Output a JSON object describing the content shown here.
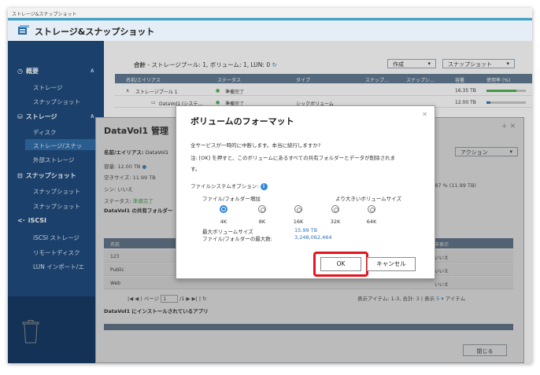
{
  "window_title": "ストレージ&スナップショット",
  "app": {
    "name": "ストレージ&スナップショット"
  },
  "sidebar": {
    "sections": [
      {
        "label": "概要",
        "items": [
          "ストレージ",
          "スナップショット"
        ]
      },
      {
        "label": "ストレージ",
        "items": [
          "ディスク",
          "ストレージ/スナッ",
          "外部ストレージ"
        ]
      },
      {
        "label": "スナップショット",
        "items": [
          "スナップショット",
          "スナップショット"
        ]
      },
      {
        "label": "iSCSI",
        "items": [
          "iSCSI ストレージ",
          "リモートディスク",
          "LUN インポート/エ"
        ]
      }
    ]
  },
  "main": {
    "summary_label": "合計",
    "summary_text": "- ストレージプール: 1, ボリューム: 1, LUN: 0",
    "buttons": {
      "create": "作成",
      "snapshot": "スナップショット"
    },
    "columns": [
      "名前/エイリアス",
      "ステータス",
      "タイプ",
      "スナップ...",
      "スナップシ...",
      "容量",
      "使用率 (%)"
    ],
    "rows": [
      {
        "name": "ストレージプール 1",
        "status": "準備完了",
        "type": "",
        "capacity": "16.35 TB",
        "usage": 0.75
      },
      {
        "name": "DataVol1 (システ...",
        "status": "準備完了",
        "type": "シックボリューム",
        "capacity": "12.00 TB",
        "usage": 0.1
      }
    ]
  },
  "manager": {
    "title": "DataVol1 管理",
    "name_label": "名前/エイリアス:",
    "name_value": "DataVol1",
    "capacity_label": "容量:",
    "capacity_value": "12.00 TB",
    "free_label": "空きサイズ:",
    "free_value": "11.99 TB",
    "thin_label": "シン:",
    "thin_value": "いいえ",
    "status_label": "ステータス:",
    "status_value": "準備完了",
    "shared_header": "DataVol1 の共有フォルダー",
    "usage_note": "9.87 % (11.99 TB)",
    "action_button": "アクション",
    "table_cols": [
      "名前",
      "非表示"
    ],
    "shares": [
      {
        "name": "123",
        "hidden": "いいえ"
      },
      {
        "name": "Public",
        "hidden": "いいえ"
      },
      {
        "name": "Web",
        "hidden": "いいえ"
      }
    ],
    "pager": {
      "page_label": "ページ",
      "page": "1",
      "total": "/1",
      "items": "表示アイテム: 1-3, 合計: 3",
      "show_label": "表示",
      "show_value": "5",
      "items_unit": "アイテム"
    },
    "apps_header": "DataVol1 にインストールされているアプリ",
    "close_button": "閉じる"
  },
  "dialog": {
    "title": "ボリュームのフォーマット",
    "line1": "全サービスが一時的に中断します。本当に続行しますか?",
    "line2": "注: [OK] を押すと、このボリュームにあるすべての共有フォルダーとデータが削除されま",
    "line3": "す。",
    "fs_label": "ファイルシステムオプション:",
    "left_hint": "ファイル/フォルダー増加",
    "right_hint": "より大きいボリュームサイズ",
    "options": [
      {
        "label": "4K",
        "selected": true
      },
      {
        "label": "8K",
        "selected": false
      },
      {
        "label": "16K",
        "selected": false
      },
      {
        "label": "32K",
        "selected": false
      },
      {
        "label": "64K",
        "selected": false
      }
    ],
    "max_volume_label": "最大ボリュームサイズ",
    "max_volume_value": "15.99 TB",
    "max_files_label": "ファイル/フォルダーの最大数:",
    "max_files_value": "3,248,062,464",
    "ok": "OK",
    "cancel": "キャンセル"
  },
  "colors": {
    "accent": "#2f86d8",
    "sidebar": "#18467a",
    "highlight": "#e3131f",
    "ok_status": "#4caf50"
  }
}
